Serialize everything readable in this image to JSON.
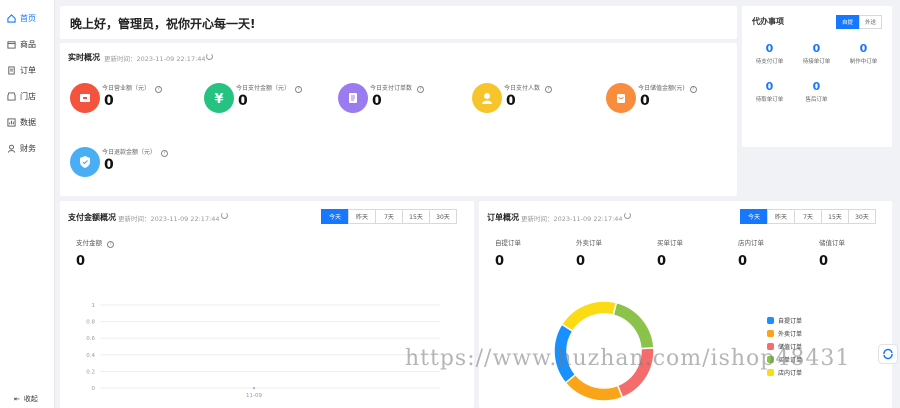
{
  "sidebar": {
    "items": [
      {
        "label": "首页",
        "icon": "home-icon",
        "active": true
      },
      {
        "label": "商品",
        "icon": "goods-icon"
      },
      {
        "label": "订单",
        "icon": "order-icon"
      },
      {
        "label": "门店",
        "icon": "store-icon"
      },
      {
        "label": "数据",
        "icon": "data-icon"
      },
      {
        "label": "财务",
        "icon": "finance-icon"
      }
    ],
    "collapse_label": "收起"
  },
  "greeting": "晚上好，管理员，祝你开心每一天!",
  "realtime": {
    "title": "实时概况",
    "time": "更新时间：2023-11-09 22:17:44",
    "stats": [
      {
        "label": "今日营业额（元）",
        "value": "0",
        "color": "#f4533d"
      },
      {
        "label": "今日支付金额（元）",
        "value": "0",
        "color": "#26c281"
      },
      {
        "label": "今日支付订单数",
        "value": "0",
        "color": "#9b7bf0"
      },
      {
        "label": "今日支付人数",
        "value": "0",
        "color": "#f7c52b"
      },
      {
        "label": "今日储值金额(元)",
        "value": "0",
        "color": "#fa8c3e"
      },
      {
        "label": "今日退款金额（元）",
        "value": "0",
        "color": "#4aaef5"
      }
    ]
  },
  "todo": {
    "title": "代办事项",
    "toggle": [
      "自提",
      "外送"
    ],
    "items": [
      {
        "value": "0",
        "label": "待支付订单"
      },
      {
        "value": "0",
        "label": "待接单订单"
      },
      {
        "value": "0",
        "label": "制作中订单"
      },
      {
        "value": "0",
        "label": "待取单订单"
      },
      {
        "value": "0",
        "label": "售后订单"
      }
    ]
  },
  "pay": {
    "title": "支付金额概况",
    "time": "更新时间：2023-11-09 22:17:44",
    "tabs": [
      "今天",
      "昨天",
      "7天",
      "15天",
      "30天"
    ],
    "metric_label": "支付金额",
    "metric_value": "0"
  },
  "order": {
    "title": "订单概况",
    "time": "更新时间：2023-11-09 22:17:44",
    "tabs": [
      "今天",
      "昨天",
      "7天",
      "15天",
      "30天"
    ],
    "metrics": [
      {
        "label": "自提订单",
        "value": "0"
      },
      {
        "label": "外卖订单",
        "value": "0"
      },
      {
        "label": "买单订单",
        "value": "0"
      },
      {
        "label": "店内订单",
        "value": "0"
      },
      {
        "label": "储值订单",
        "value": "0"
      }
    ]
  },
  "chart_data": [
    {
      "type": "line",
      "categories": [
        "11-09"
      ],
      "series": [
        {
          "values": [
            0
          ]
        }
      ],
      "y_ticks": [
        "0",
        "0.2",
        "0.4",
        "0.6",
        "0.8",
        "1"
      ],
      "ylim": [
        0,
        1
      ]
    },
    {
      "type": "pie",
      "categories": [
        "自提订单",
        "外卖订单",
        "储值订单",
        "买单订单",
        "店内订单"
      ],
      "values": [
        1,
        1,
        1,
        1,
        1
      ],
      "colors": [
        "#1890ff",
        "#faa41a",
        "#f56c6c",
        "#8bc34a",
        "#fadb14"
      ]
    }
  ],
  "watermark": "https://www.huzhan.com/ishop48431"
}
